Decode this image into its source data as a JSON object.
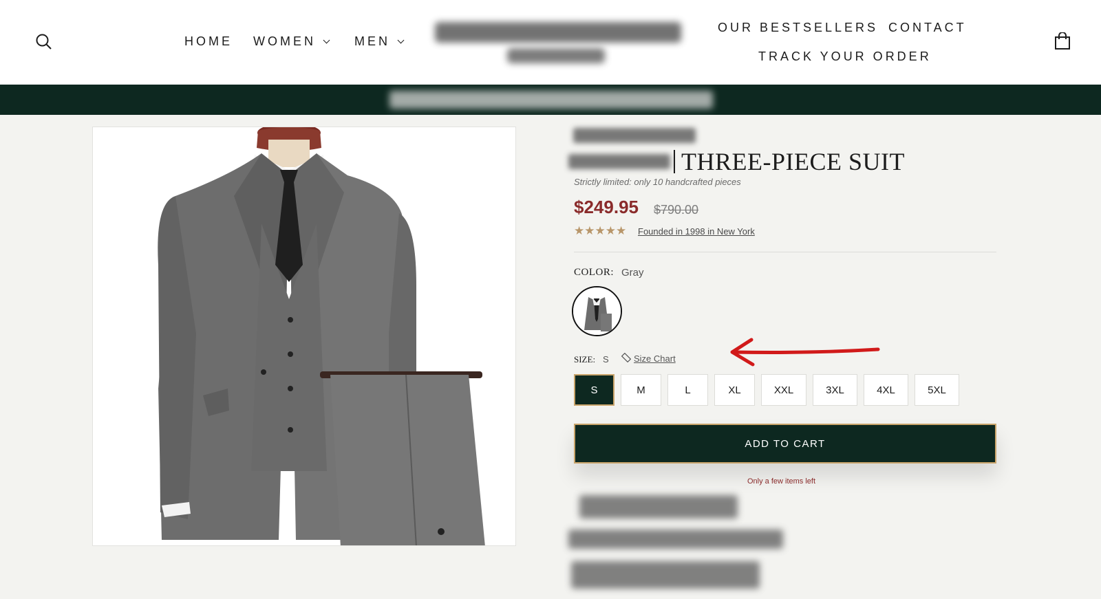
{
  "header": {
    "nav_left": [
      {
        "label": "HOME"
      },
      {
        "label": "WOMEN"
      },
      {
        "label": "MEN"
      }
    ],
    "nav_right": [
      {
        "label": "OUR BESTSELLERS"
      },
      {
        "label": "CONTACT"
      },
      {
        "label": "TRACK YOUR ORDER"
      }
    ],
    "icons": {
      "search": "search-icon",
      "cart": "shopping-bag-icon"
    }
  },
  "product": {
    "title": "THREE-PIECE SUIT",
    "limited_note": "Strictly limited: only 10 handcrafted pieces",
    "price": "$249.95",
    "compare_price": "$790.00",
    "rating_stars": "★★★★★",
    "rating_value": 5,
    "founded_link": "Founded in 1998 in New York",
    "color_label": "COLOR:",
    "color_value": "Gray",
    "size_label": "SIZE:",
    "size_value": "S",
    "size_chart_label": "Size Chart",
    "sizes": [
      "S",
      "M",
      "L",
      "XL",
      "XXL",
      "3XL",
      "4XL",
      "5XL"
    ],
    "selected_size": "S",
    "add_to_cart": "ADD TO CART",
    "stock_note": "Only a few items left"
  },
  "colors": {
    "accent_dark": "#0d2820",
    "gold_border": "#c9a46a",
    "price_red": "#8a2b2b",
    "star_gold": "#b8966a",
    "annotation_arrow": "#d11a1a"
  }
}
